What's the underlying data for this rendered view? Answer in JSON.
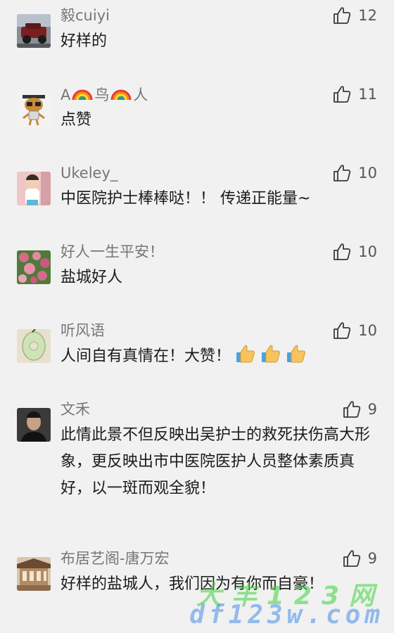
{
  "comments": [
    {
      "name": "毅cuiyi",
      "text": "好样的",
      "likes": "12",
      "avatar": "car-avatar"
    },
    {
      "name_parts": [
        "A",
        "鸟",
        "人"
      ],
      "text": "点赞",
      "likes": "11",
      "avatar": "cartoon-avatar"
    },
    {
      "name": "Ukeley_",
      "text": "中医院护士棒棒哒！！ 传递正能量~",
      "likes": "10",
      "avatar": "child-avatar"
    },
    {
      "name": "好人一生平安！",
      "text": "盐城好人",
      "likes": "10",
      "avatar": "roses-avatar"
    },
    {
      "name": "听风语",
      "text": "人间自有真情在！大赞！",
      "likes": "10",
      "avatar": "jade-avatar"
    },
    {
      "name": "文禾",
      "text": "此情此景不但反映出吴护士的救死扶伤高大形象，更反映出市中医院医护人员整体素质真好，以一斑而观全貌！",
      "likes": "9",
      "avatar": "man-avatar"
    },
    {
      "name": "布居艺阁-唐万宏",
      "text": "好样的盐城人，我们因为有你而自豪！",
      "likes": "9",
      "avatar": "house-avatar"
    }
  ],
  "watermark": {
    "line1": "大丰123网",
    "line2": "df123w.com"
  },
  "colors": {
    "name": "#767676",
    "text": "#1b1b1b",
    "background": "#f1f1f1",
    "like_icon": "#3a3a3a"
  }
}
